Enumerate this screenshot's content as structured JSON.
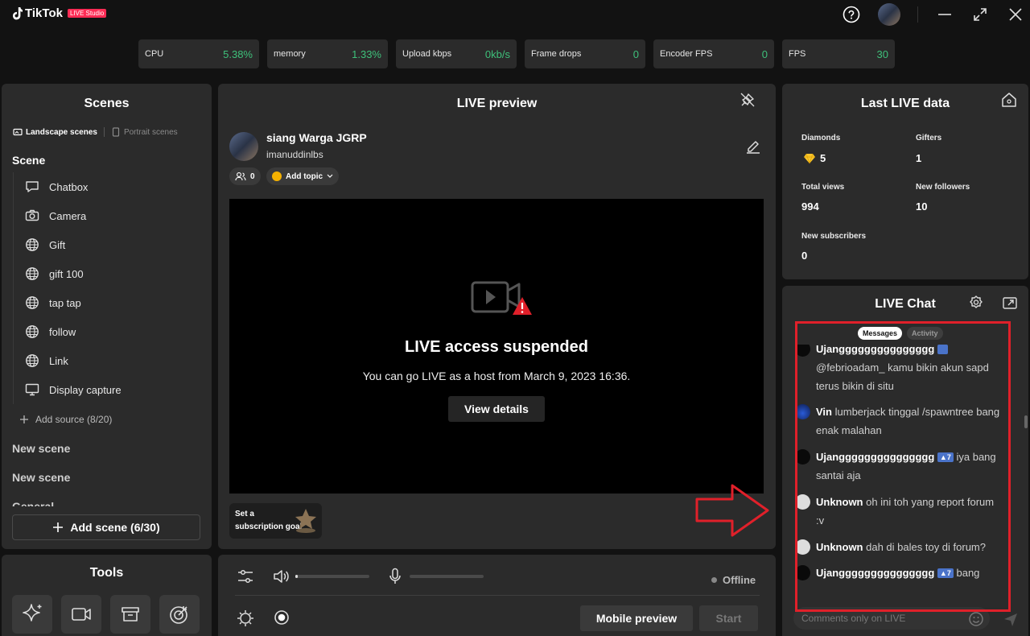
{
  "app": {
    "brand": "TikTok",
    "badge": "LIVE Studio"
  },
  "stats": [
    {
      "label": "CPU",
      "value": "5.38%"
    },
    {
      "label": "memory",
      "value": "1.33%"
    },
    {
      "label": "Upload kbps",
      "value": "0kb/s"
    },
    {
      "label": "Frame drops",
      "value": "0"
    },
    {
      "label": "Encoder FPS",
      "value": "0"
    },
    {
      "label": "FPS",
      "value": "30"
    }
  ],
  "scenes": {
    "title": "Scenes",
    "tab_landscape": "Landscape scenes",
    "tab_portrait": "Portrait scenes",
    "scene_label": "Scene",
    "sources": [
      {
        "label": "Chatbox",
        "icon": "chatbox-icon"
      },
      {
        "label": "Camera",
        "icon": "camera-icon"
      },
      {
        "label": "Gift",
        "icon": "globe-icon"
      },
      {
        "label": "gift 100",
        "icon": "globe-icon"
      },
      {
        "label": "tap tap",
        "icon": "globe-icon"
      },
      {
        "label": "follow",
        "icon": "globe-icon"
      },
      {
        "label": "Link",
        "icon": "globe-icon"
      },
      {
        "label": "Display capture",
        "icon": "monitor-icon"
      }
    ],
    "add_source": "Add source (8/20)",
    "new_scenes": [
      "New scene",
      "New scene",
      "General"
    ],
    "add_scene": "Add scene (6/30)"
  },
  "tools": {
    "title": "Tools"
  },
  "preview": {
    "title": "LIVE preview",
    "host_name": "siang Warga JGRP",
    "host_handle": "imanuddinlbs",
    "viewers": "0",
    "add_topic": "Add topic",
    "suspended_title": "LIVE access suspended",
    "suspended_sub": "You can go LIVE as a host from March 9, 2023 16:36.",
    "view_details": "View details",
    "subscription_goal": "Set a subscription goal"
  },
  "controls": {
    "status": "Offline",
    "mobile_preview": "Mobile preview",
    "start": "Start"
  },
  "last_live": {
    "title": "Last LIVE data",
    "items": [
      {
        "label": "Diamonds",
        "value": "5"
      },
      {
        "label": "Gifters",
        "value": "1"
      },
      {
        "label": "Total views",
        "value": "994"
      },
      {
        "label": "New followers",
        "value": "10"
      },
      {
        "label": "New subscribers",
        "value": "0"
      }
    ]
  },
  "chat": {
    "title": "LIVE Chat",
    "tab_messages": "Messages",
    "tab_activity": "Activity",
    "messages": [
      {
        "name": "Ujanggggggggggggggg",
        "level": "",
        "text": "@febrioadam_ kamu bikin akun sapd terus bikin di situ"
      },
      {
        "name": "Vin",
        "level": "",
        "text": "lumberjack tinggal /spawntree bang enak malahan"
      },
      {
        "name": "Ujanggggggggggggggg",
        "level": "7",
        "text": "iya bang santai aja"
      },
      {
        "name": "Unknown",
        "level": "",
        "text": "oh ini toh yang report forum :v"
      },
      {
        "name": "Unknown",
        "level": "",
        "text": "dah di bales toy di forum?"
      },
      {
        "name": "Ujanggggggggggggggg",
        "level": "7",
        "text": "bang"
      }
    ],
    "comment_placeholder": "Comments only on LIVE"
  },
  "colors": {
    "accent": "#fe2c55",
    "stat_value": "#3ec07a",
    "annotation": "#e0202a",
    "level_badge": "#4a73c9"
  }
}
